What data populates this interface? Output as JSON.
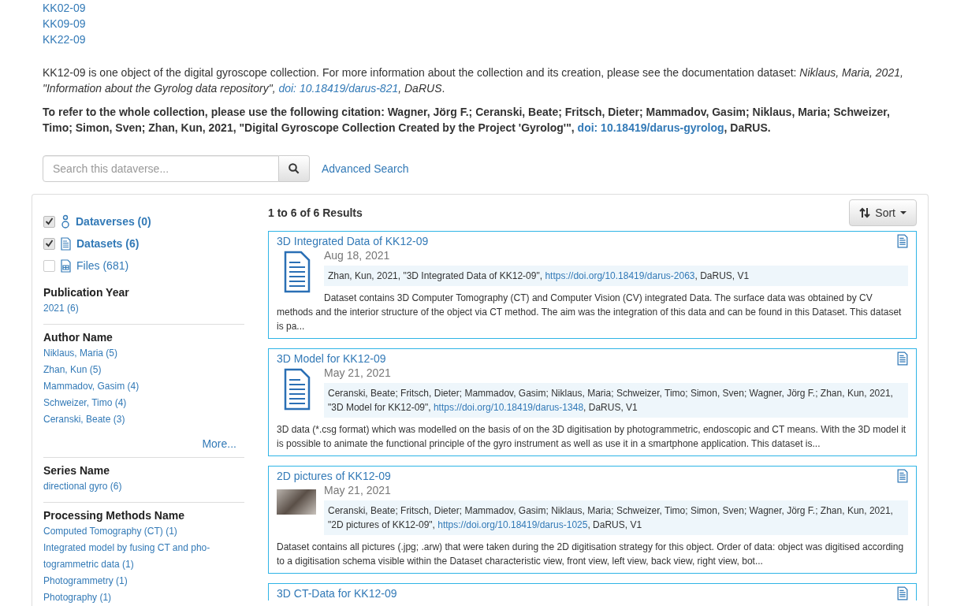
{
  "related_links": [
    "KK02-09",
    "KK09-09",
    "KK22-09"
  ],
  "intro": [
    {
      "kind": "plain",
      "text": "KK12-09 is one object of the digital gyroscope collection. For more information about the collection and its creation, please see the documentation dataset: "
    },
    {
      "kind": "italic",
      "text": "Niklaus, Maria, 2021, \"Information about the Gyrolog data repository\", "
    },
    {
      "kind": "link",
      "text": "doi: 10.18419/darus-821"
    },
    {
      "kind": "italic",
      "text": ", DaRUS"
    },
    {
      "kind": "plain",
      "text": "."
    }
  ],
  "collection_citation": [
    {
      "kind": "plain",
      "text": "To refer to the whole collection, please use the following citation: Wagner, Jörg F.; Ceranski, Beate; Fritsch, Dieter; Mammadov, Gasim; Niklaus, Maria; Schweizer, Timo; Simon, Sven; Zhan, Kun, 2021, \"Digital Gyroscope Collection Created by the Project 'Gyrolog'\", "
    },
    {
      "kind": "link",
      "text": "doi: 10.18419/darus-gyrolog"
    },
    {
      "kind": "plain",
      "text": ", DaRUS."
    }
  ],
  "search": {
    "placeholder": "Search this dataverse...",
    "advanced_link": "Advanced Search"
  },
  "facets": {
    "types": [
      {
        "kind": "dataverse",
        "label": "Dataverses (0)",
        "checked": true
      },
      {
        "kind": "dataset",
        "label": "Datasets (6)",
        "checked": true
      },
      {
        "kind": "file",
        "label": "Files (681)",
        "checked": false
      }
    ],
    "groups": [
      {
        "title": "Publication Year",
        "items": [
          "2021 (6)"
        ]
      },
      {
        "title": "Author Name",
        "items": [
          "Niklaus, Maria (5)",
          "Zhan, Kun (5)",
          "Mammadov, Gasim (4)",
          "Schweizer, Timo (4)",
          "Ceranski, Beate (3)"
        ],
        "more": "More..."
      },
      {
        "title": "Series Name",
        "items": [
          "directional gyro (6)"
        ]
      },
      {
        "title": "Processing Methods Name",
        "items": [
          "Computed Tomography (CT) (1)",
          "Integrated model by fusing CT and pho-togrammetric data (1)",
          "Photogrammetry (1)",
          "Photography (1)"
        ]
      }
    ]
  },
  "results": {
    "summary": "1 to 6 of 6 Results",
    "sort_button": "Sort",
    "items": [
      {
        "title": "3D Integrated Data of KK12-09",
        "kind": "document",
        "date": "Aug 18, 2021",
        "citation": [
          {
            "kind": "plain",
            "text": "Zhan, Kun, 2021, \"3D Integrated Data of KK12-09\", "
          },
          {
            "kind": "link",
            "text": "https://doi.org/10.18419/darus-2063"
          },
          {
            "kind": "plain",
            "text": ", DaRUS, V1"
          }
        ],
        "description": "Dataset contains 3D Computer Tomography (CT) and Computer Vision (CV) integrated Data. The surface data was obtained by CV methods and the interior structure of the object via CT method. The aim was the integration of this data and can be found in this Dataset. This dataset is pa..."
      },
      {
        "title": "3D Model for KK12-09",
        "kind": "document",
        "date": "May 21, 2021",
        "citation": [
          {
            "kind": "plain",
            "text": "Ceranski, Beate; Fritsch, Dieter; Mammadov, Gasim; Niklaus, Maria; Schweizer, Timo; Simon, Sven; Wagner, Jörg F.; Zhan, Kun, 2021, \"3D Model for KK12-09\", "
          },
          {
            "kind": "link",
            "text": "https://doi.org/10.18419/darus-1348"
          },
          {
            "kind": "plain",
            "text": ", DaRUS, V1"
          }
        ],
        "description": "3D data (*.csg format) which was modelled on the basis of on the 3D digitisation by photogrammetric, endoscopic and CT means. With the 3D model it is possible to animate the functional principle of the gyro instrument as well as use it in a smartphone application. This dataset is..."
      },
      {
        "title": "2D pictures of KK12-09",
        "kind": "photo",
        "date": "May 21, 2021",
        "citation": [
          {
            "kind": "plain",
            "text": "Ceranski, Beate; Fritsch, Dieter; Mammadov, Gasim; Niklaus, Maria; Schweizer, Timo; Simon, Sven; Wagner, Jörg F.; Zhan, Kun, 2021, \"2D pictures of KK12-09\", "
          },
          {
            "kind": "link",
            "text": "https://doi.org/10.18419/darus-1025"
          },
          {
            "kind": "plain",
            "text": ", DaRUS, V1"
          }
        ],
        "description": "Dataset contains all pictures (.jpg; .arw) that were taken during the 2D digitisation strategy for this object. Order of data: object was digitised according to a digitisation schema visible within the Dataset characteristic view, front view, left view, back view, right view, bot..."
      },
      {
        "title": "3D CT-Data for KK12-09"
      }
    ]
  }
}
